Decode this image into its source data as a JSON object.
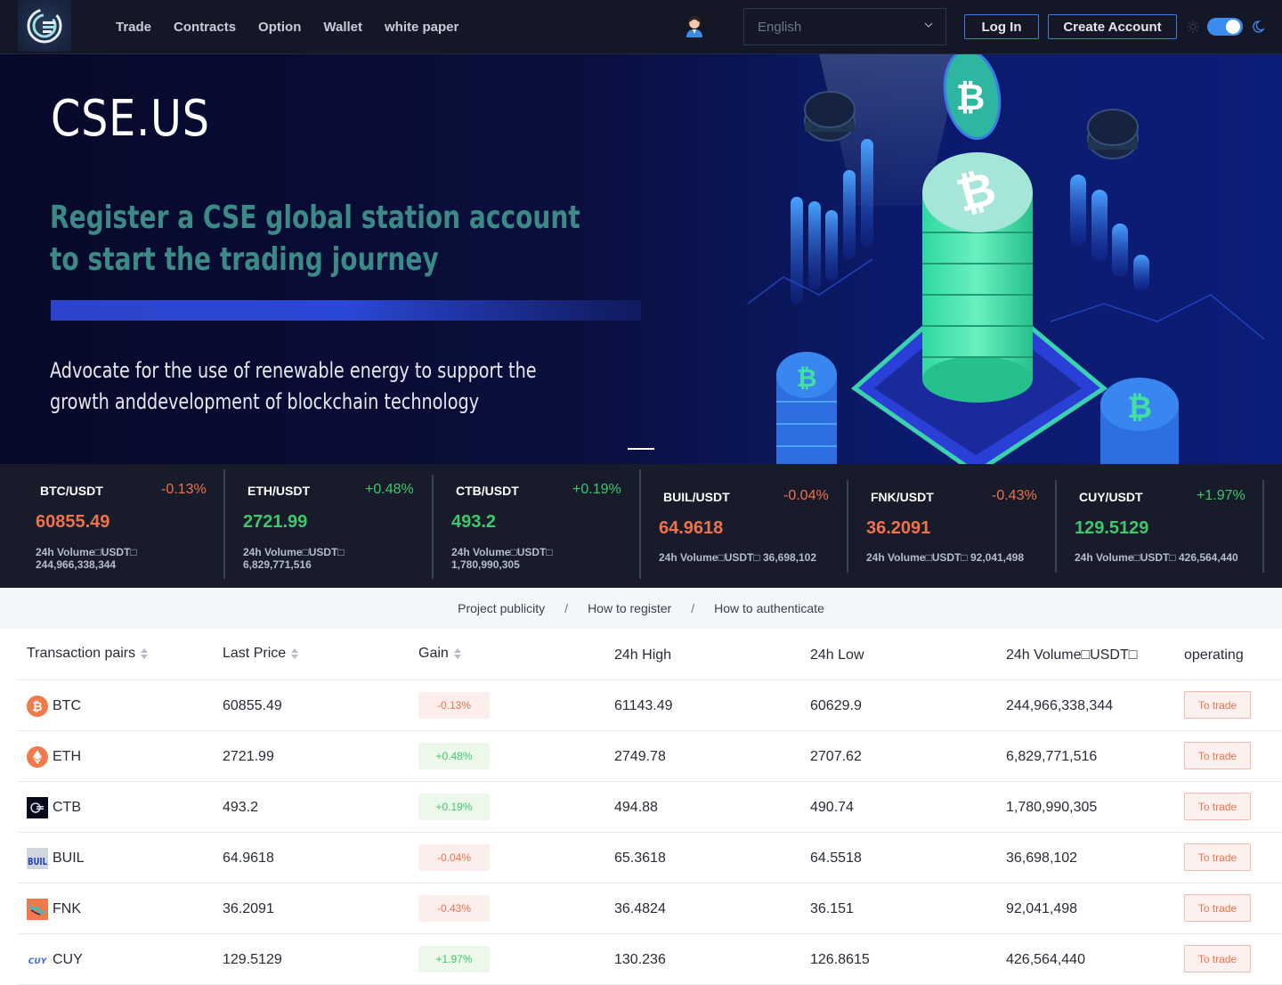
{
  "header": {
    "logo_alt": "CSE logo",
    "nav": [
      "Trade",
      "Contracts",
      "Option",
      "Wallet",
      "white paper"
    ],
    "language": "English",
    "login_label": "Log In",
    "create_account_label": "Create Account",
    "theme": "dark",
    "icons": {
      "support": "customer-service-icon",
      "chevron": "chevron-down-icon",
      "sun": "sun-icon",
      "moon": "moon-icon"
    }
  },
  "hero": {
    "title": "CSE.US",
    "subtitle_line1": "Register a  CSE global station account",
    "subtitle_line2": "to start the trading journey",
    "desc_line1": "Advocate for the use of renewable energy to support the",
    "desc_line2": "growth anddevelopment of blockchain technology"
  },
  "ticker": [
    {
      "pair": "BTC/USDT",
      "change": "-0.13%",
      "price": "60855.49",
      "vol_label": "24h Volume□USDT□",
      "volume": "244,966,338,344",
      "dir": "down"
    },
    {
      "pair": "ETH/USDT",
      "change": "+0.48%",
      "price": "2721.99",
      "vol_label": "24h Volume□USDT□",
      "volume": "6,829,771,516",
      "dir": "up"
    },
    {
      "pair": "CTB/USDT",
      "change": "+0.19%",
      "price": "493.2",
      "vol_label": "24h Volume□USDT□",
      "volume": "1,780,990,305",
      "dir": "up"
    },
    {
      "pair": "BUIL/USDT",
      "change": "-0.04%",
      "price": "64.9618",
      "vol_label": "24h Volume□USDT□",
      "volume": "36,698,102",
      "dir": "down"
    },
    {
      "pair": "FNK/USDT",
      "change": "-0.43%",
      "price": "36.2091",
      "vol_label": "24h Volume□USDT□",
      "volume": "92,041,498",
      "dir": "down"
    },
    {
      "pair": "CUY/USDT",
      "change": "+1.97%",
      "price": "129.5129",
      "vol_label": "24h Volume□USDT□",
      "volume": "426,564,440",
      "dir": "up"
    }
  ],
  "subnav": {
    "links": [
      "Project publicity",
      "How to register",
      "How to authenticate"
    ],
    "separator": "/"
  },
  "table": {
    "headers": [
      "Transaction pairs",
      "Last Price",
      "Gain",
      "24h High",
      "24h Low",
      "24h Volume□USDT□",
      "operating"
    ],
    "action_label": "To trade",
    "rows": [
      {
        "coin": "BTC",
        "last": "60855.49",
        "gain": "-0.13%",
        "dir": "down",
        "high": "61143.49",
        "low": "60629.9",
        "volume": "244,966,338,344"
      },
      {
        "coin": "ETH",
        "last": "2721.99",
        "gain": "+0.48%",
        "dir": "up",
        "high": "2749.78",
        "low": "2707.62",
        "volume": "6,829,771,516"
      },
      {
        "coin": "CTB",
        "last": "493.2",
        "gain": "+0.19%",
        "dir": "up",
        "high": "494.88",
        "low": "490.74",
        "volume": "1,780,990,305"
      },
      {
        "coin": "BUIL",
        "last": "64.9618",
        "gain": "-0.04%",
        "dir": "down",
        "high": "65.3618",
        "low": "64.5518",
        "volume": "36,698,102"
      },
      {
        "coin": "FNK",
        "last": "36.2091",
        "gain": "-0.43%",
        "dir": "down",
        "high": "36.4824",
        "low": "36.151",
        "volume": "92,041,498"
      },
      {
        "coin": "CUY",
        "last": "129.5129",
        "gain": "+1.97%",
        "dir": "up",
        "high": "130.236",
        "low": "126.8615",
        "volume": "426,564,440"
      }
    ]
  },
  "colors": {
    "down": "#f0714a",
    "up": "#3fc76c",
    "accent": "#3b8cf0",
    "header_bg": "#141826"
  }
}
